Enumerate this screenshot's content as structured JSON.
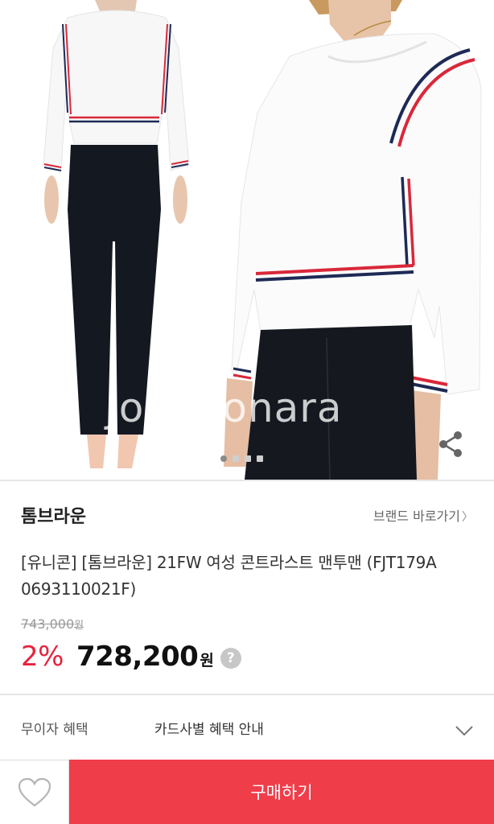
{
  "product_image": {
    "alt": "Model wearing white sweatshirt with red, white and navy stripes and black flared pants",
    "watermark": "Joongonara",
    "pagination": {
      "total": 4,
      "active": 0
    },
    "share_icon": "share-icon"
  },
  "brand": {
    "name": "톰브라운",
    "link_label": "브랜드 바로가기",
    "link_icon": "chevron-right-icon"
  },
  "product": {
    "title": "[유니콘] [톰브라운] 21FW 여성 콘트라스트 맨투맨 (FJT179A 0693110021F)",
    "original_price": "743,000",
    "original_price_unit": "원",
    "discount": "2%",
    "sale_price": "728,200",
    "sale_price_unit": "원",
    "help_icon": "?"
  },
  "benefit": {
    "label": "무이자 혜택",
    "text": "카드사별 혜택 안내",
    "icon": "chevron-down-icon"
  },
  "actions": {
    "wish_icon": "heart-icon",
    "buy_label": "구매하기"
  },
  "colors": {
    "accent": "#f03d4a",
    "discount": "#e8233c"
  }
}
